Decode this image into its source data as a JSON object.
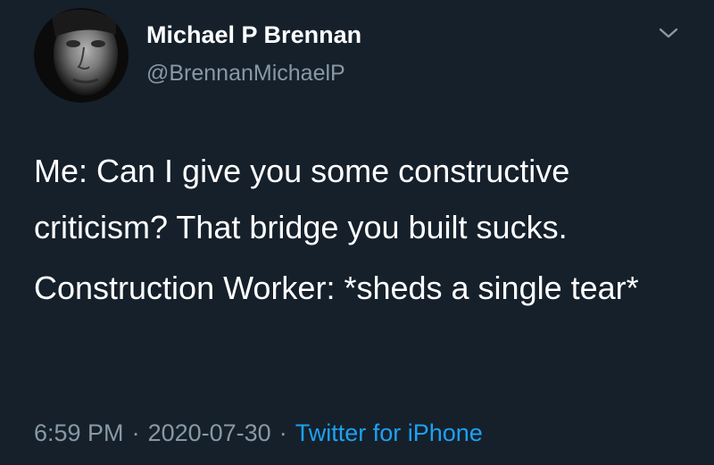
{
  "author": {
    "display_name": "Michael P Brennan",
    "handle": "@BrennanMichaelP"
  },
  "tweet": {
    "paragraphs": [
      "Me: Can I give you some constructive criticism? That bridge you built sucks.",
      "Construction Worker: *sheds a single tear*"
    ]
  },
  "meta": {
    "time": "6:59 PM",
    "separator": "·",
    "date": "2020-07-30",
    "source": "Twitter for iPhone"
  },
  "icons": {
    "more": "chevron-down-icon"
  },
  "colors": {
    "background": "#15202b",
    "text": "#ffffff",
    "secondary": "#8899a6",
    "link": "#1da1f2"
  }
}
